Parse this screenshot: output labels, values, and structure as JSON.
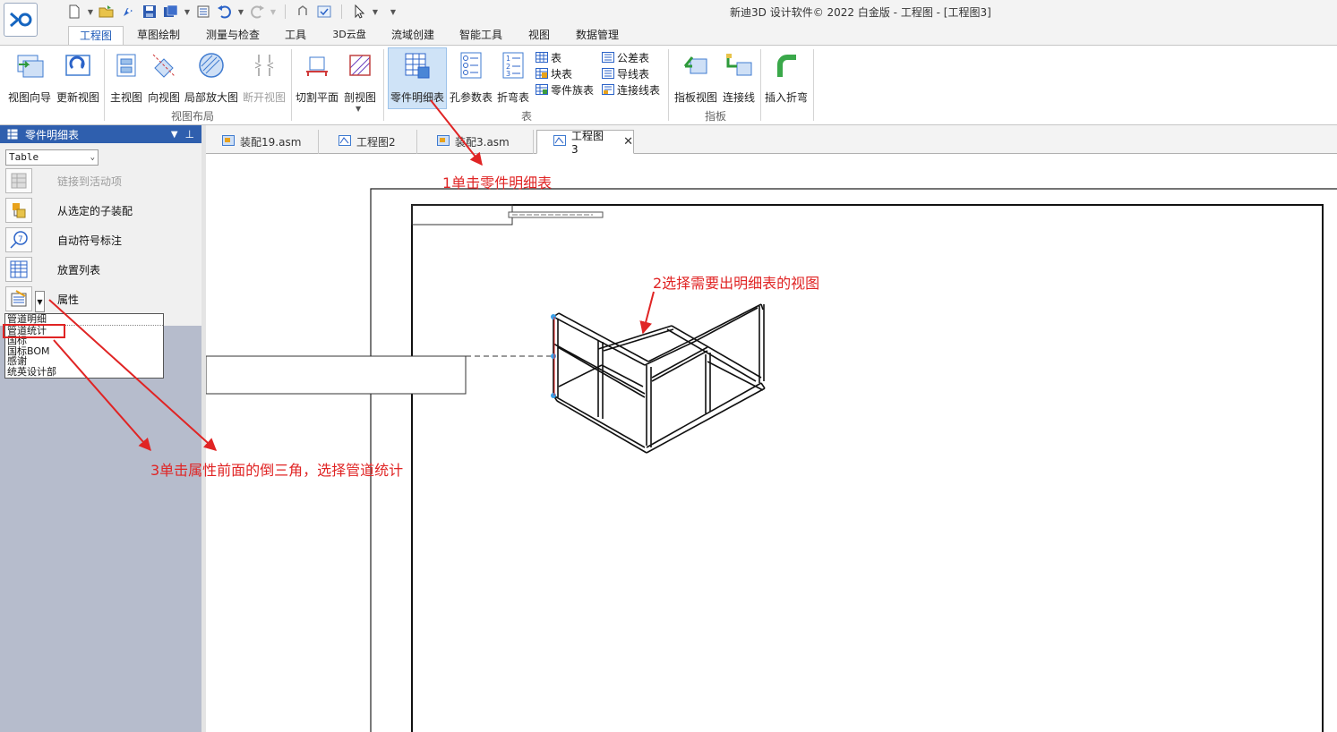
{
  "window": {
    "title": "新迪3D 设计软件© 2022 白金版 - 工程图 - [工程图3]"
  },
  "ribbon_tabs": [
    "工程图",
    "草图绘制",
    "测量与检查",
    "工具",
    "3D云盘",
    "流域创建",
    "智能工具",
    "视图",
    "数据管理"
  ],
  "ribbon": {
    "view_buttons": [
      "视图向导",
      "更新视图"
    ],
    "layout_buttons": [
      "主视图",
      "向视图",
      "局部放大图",
      "断开视图"
    ],
    "section_buttons": [
      "切割平面",
      "剖视图"
    ],
    "layout_group_label": "视图布局",
    "table_buttons": [
      "零件明细表",
      "孔参数表",
      "折弯表"
    ],
    "table_small": [
      "表",
      "块表",
      "零件族表"
    ],
    "table_small2": [
      "公差表",
      "导线表",
      "连接线表"
    ],
    "table_group_label": "表",
    "sign_buttons": [
      "指板视图",
      "连接线"
    ],
    "sign_group_label": "指板",
    "insert_bend": "插入折弯"
  },
  "panel": {
    "title": "零件明细表",
    "select_value": "Table",
    "items": [
      "链接到活动项",
      "从选定的子装配",
      "自动符号标注",
      "放置列表",
      "属性"
    ],
    "dropdown_items": [
      "管道明细",
      "管道统计",
      "国标",
      "国标BOM",
      "感谢",
      "统英设计部"
    ]
  },
  "doc_tabs": [
    "装配19.asm",
    "工程图2",
    "装配3.asm",
    "工程图3"
  ],
  "annotations": {
    "step1": "1单击零件明细表",
    "step2": "2选择需要出明细表的视图",
    "step3": "3单击属性前面的倒三角，选择管道统计"
  },
  "colors": {
    "accent": "#2f5fae",
    "annotation": "#e02424",
    "panel_bg": "#b6bccc"
  }
}
